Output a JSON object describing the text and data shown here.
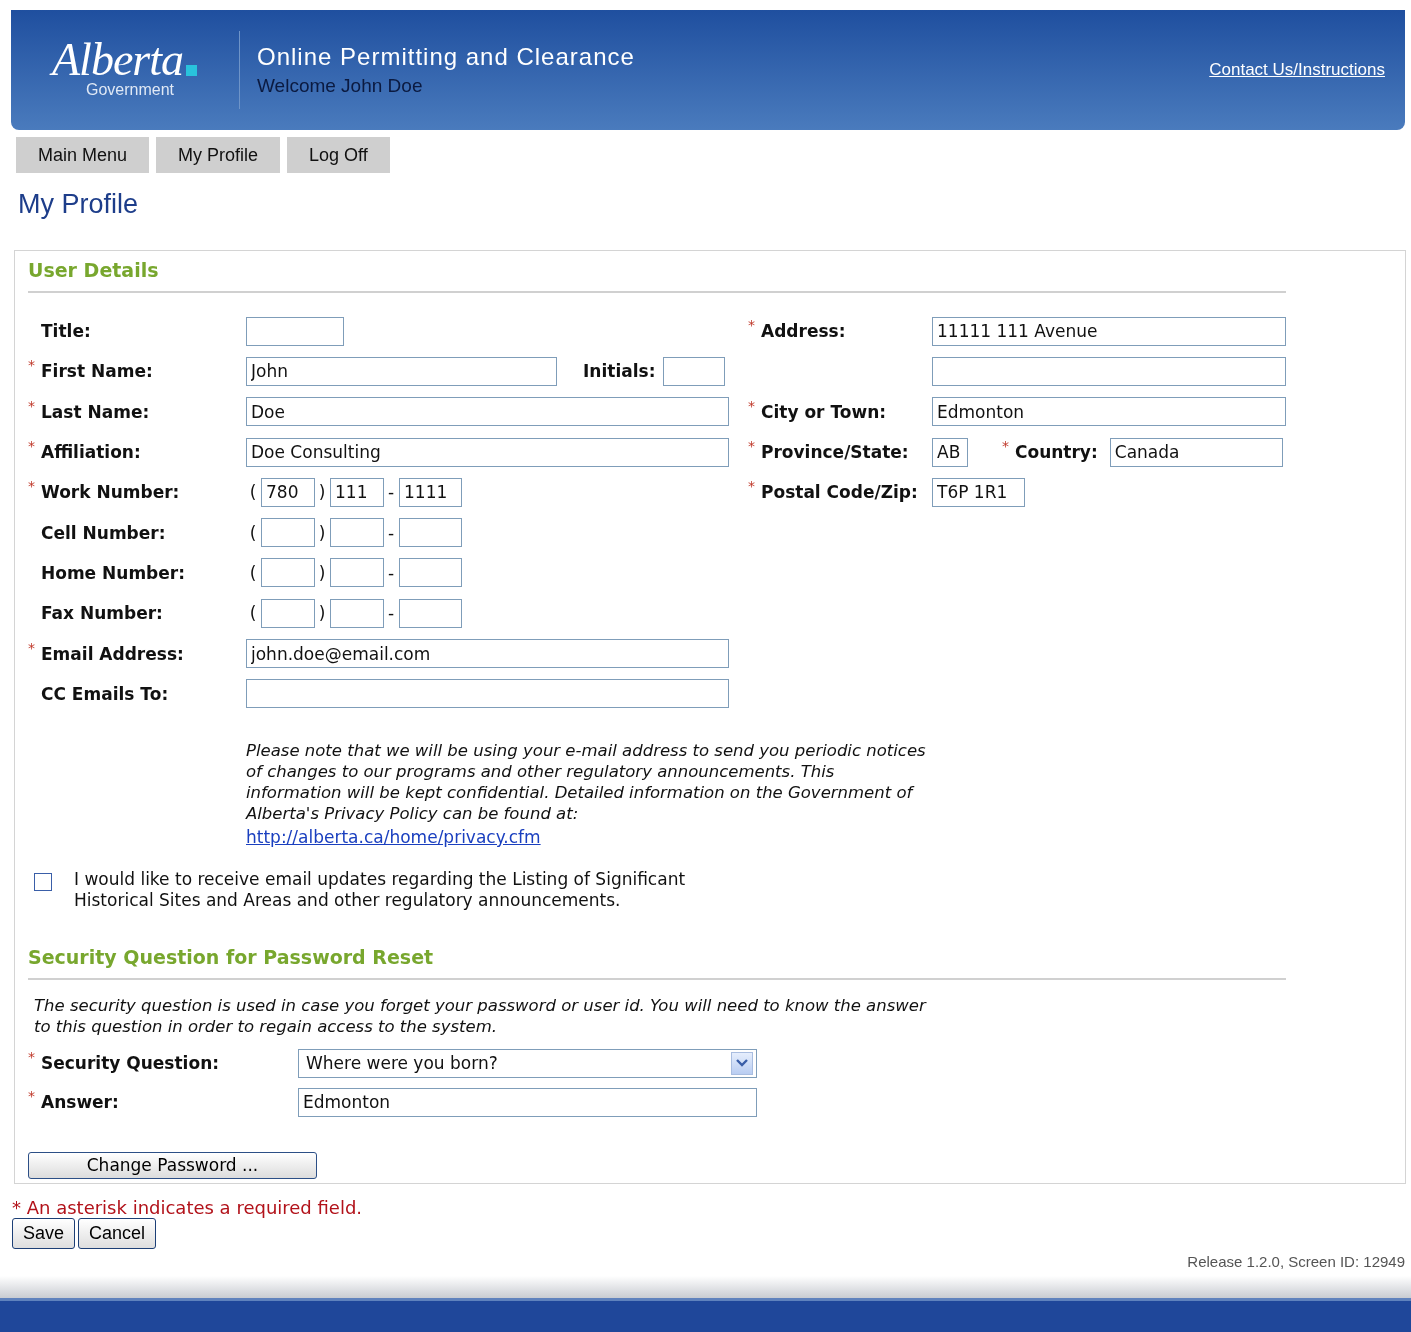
{
  "header": {
    "logo_word": "Alberta",
    "logo_sub": "Government",
    "title": "Online Permitting and Clearance",
    "welcome": "Welcome John Doe",
    "contact_link": "Contact Us/Instructions"
  },
  "nav": [
    "Main Menu",
    "My Profile",
    "Log Off"
  ],
  "page_title": "My Profile",
  "user_details": {
    "heading": "User Details",
    "left_fields": [
      {
        "kind": "short",
        "label": "Title:"
      },
      {
        "kind": "name",
        "mark": "*",
        "label": "First Name:",
        "value": "John",
        "extra_label": "Initials:"
      },
      {
        "kind": "wide",
        "mark": "*",
        "label": "Last Name:",
        "value": "Doe"
      },
      {
        "kind": "wide",
        "mark": "*",
        "label": "Affiliation:",
        "value": "Doe Consulting"
      },
      {
        "kind": "phone",
        "mark": "*",
        "label": "Work Number:",
        "open": "(",
        "close": ")",
        "dash": "-",
        "parts": [
          "780",
          "111",
          "1111"
        ]
      },
      {
        "kind": "phone",
        "label": "Cell Number:",
        "open": "(",
        "close": ")",
        "dash": "-"
      },
      {
        "kind": "phone",
        "label": "Home Number:",
        "open": "(",
        "close": ")",
        "dash": "-"
      },
      {
        "kind": "phone",
        "label": "Fax Number:",
        "open": "(",
        "close": ")",
        "dash": "-"
      },
      {
        "kind": "wide",
        "mark": "*",
        "label": "Email Address:",
        "value": "john.doe@email.com"
      },
      {
        "kind": "wide",
        "label": "CC Emails To:"
      }
    ],
    "right_fields": [
      {
        "kind": "wide",
        "mark": "*",
        "label": "Address:",
        "value": "11111 111 Avenue"
      },
      {
        "kind": "wide"
      },
      {
        "kind": "wide",
        "mark": "*",
        "label": "City or Town:",
        "value": "Edmonton"
      },
      {
        "kind": "pair",
        "mark": "*",
        "label": "Province/State:",
        "value": "AB",
        "extra_mark": "*",
        "extra_label": "Country:",
        "extra_value": "Canada"
      },
      {
        "kind": "postal",
        "mark": "*",
        "label": "Postal Code/Zip:",
        "value": "T6P 1R1"
      }
    ],
    "note": "Please note that we will be using your e-mail address to send you periodic notices of changes to our programs and other regulatory announcements. This information will be kept confidential. Detailed information on the Government of Alberta's Privacy Policy can be found at:",
    "privacy_link": "http://alberta.ca/home/privacy.cfm",
    "updates_checkbox": {
      "checked": false,
      "label": "I would like to receive email updates regarding the Listing of Significant Historical Sites and Areas and other regulatory announcements."
    }
  },
  "security": {
    "heading": "Security Question for Password Reset",
    "note": "The security question is used in case you forget your password or user id. You will need to know the answer to this question in order to regain access to the system.",
    "question": {
      "mark": "*",
      "label": "Security Question:",
      "value": "Where were you born?"
    },
    "answer": {
      "mark": "*",
      "label": "Answer:",
      "value": "Edmonton"
    },
    "change_password": "Change Password ..."
  },
  "required_note": "* An asterisk indicates a required field.",
  "buttons": [
    "Save",
    "Cancel"
  ],
  "release": "Release 1.2.0, Screen ID: 12949"
}
